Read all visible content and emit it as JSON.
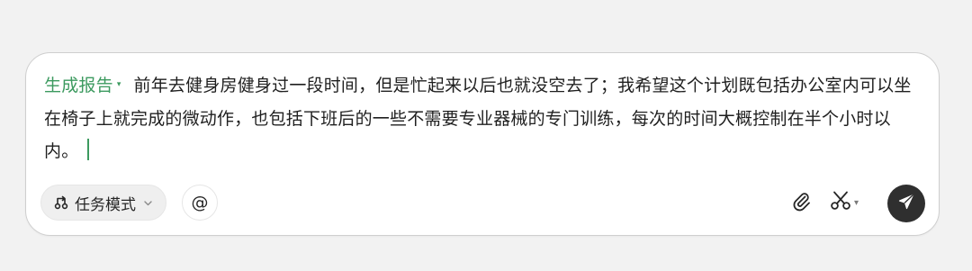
{
  "composer": {
    "mode_label": "生成报告",
    "mode_caret": "▾",
    "prompt_text": "前年去健身房健身过一段时间，但是忙起来以后也就没空去了；我希望这个计划既包括办公室内可以坐在椅子上就完成的微动作，也包括下班后的一些不需要专业器械的专门训练，每次的时间大概控制在半个小时以内。"
  },
  "toolbar": {
    "task_mode_label": "任务模式",
    "at_label": "@",
    "scissor_caret": "▾"
  },
  "icons": {
    "task_mode": "mode-icon",
    "chevron": "chevron-down-icon",
    "attach": "paperclip-icon",
    "scissor": "scissors-icon",
    "send": "send-icon"
  },
  "colors": {
    "accent_green": "#3c9a5f",
    "send_bg": "#2f2f2f",
    "page_bg": "#f2f2f2"
  }
}
